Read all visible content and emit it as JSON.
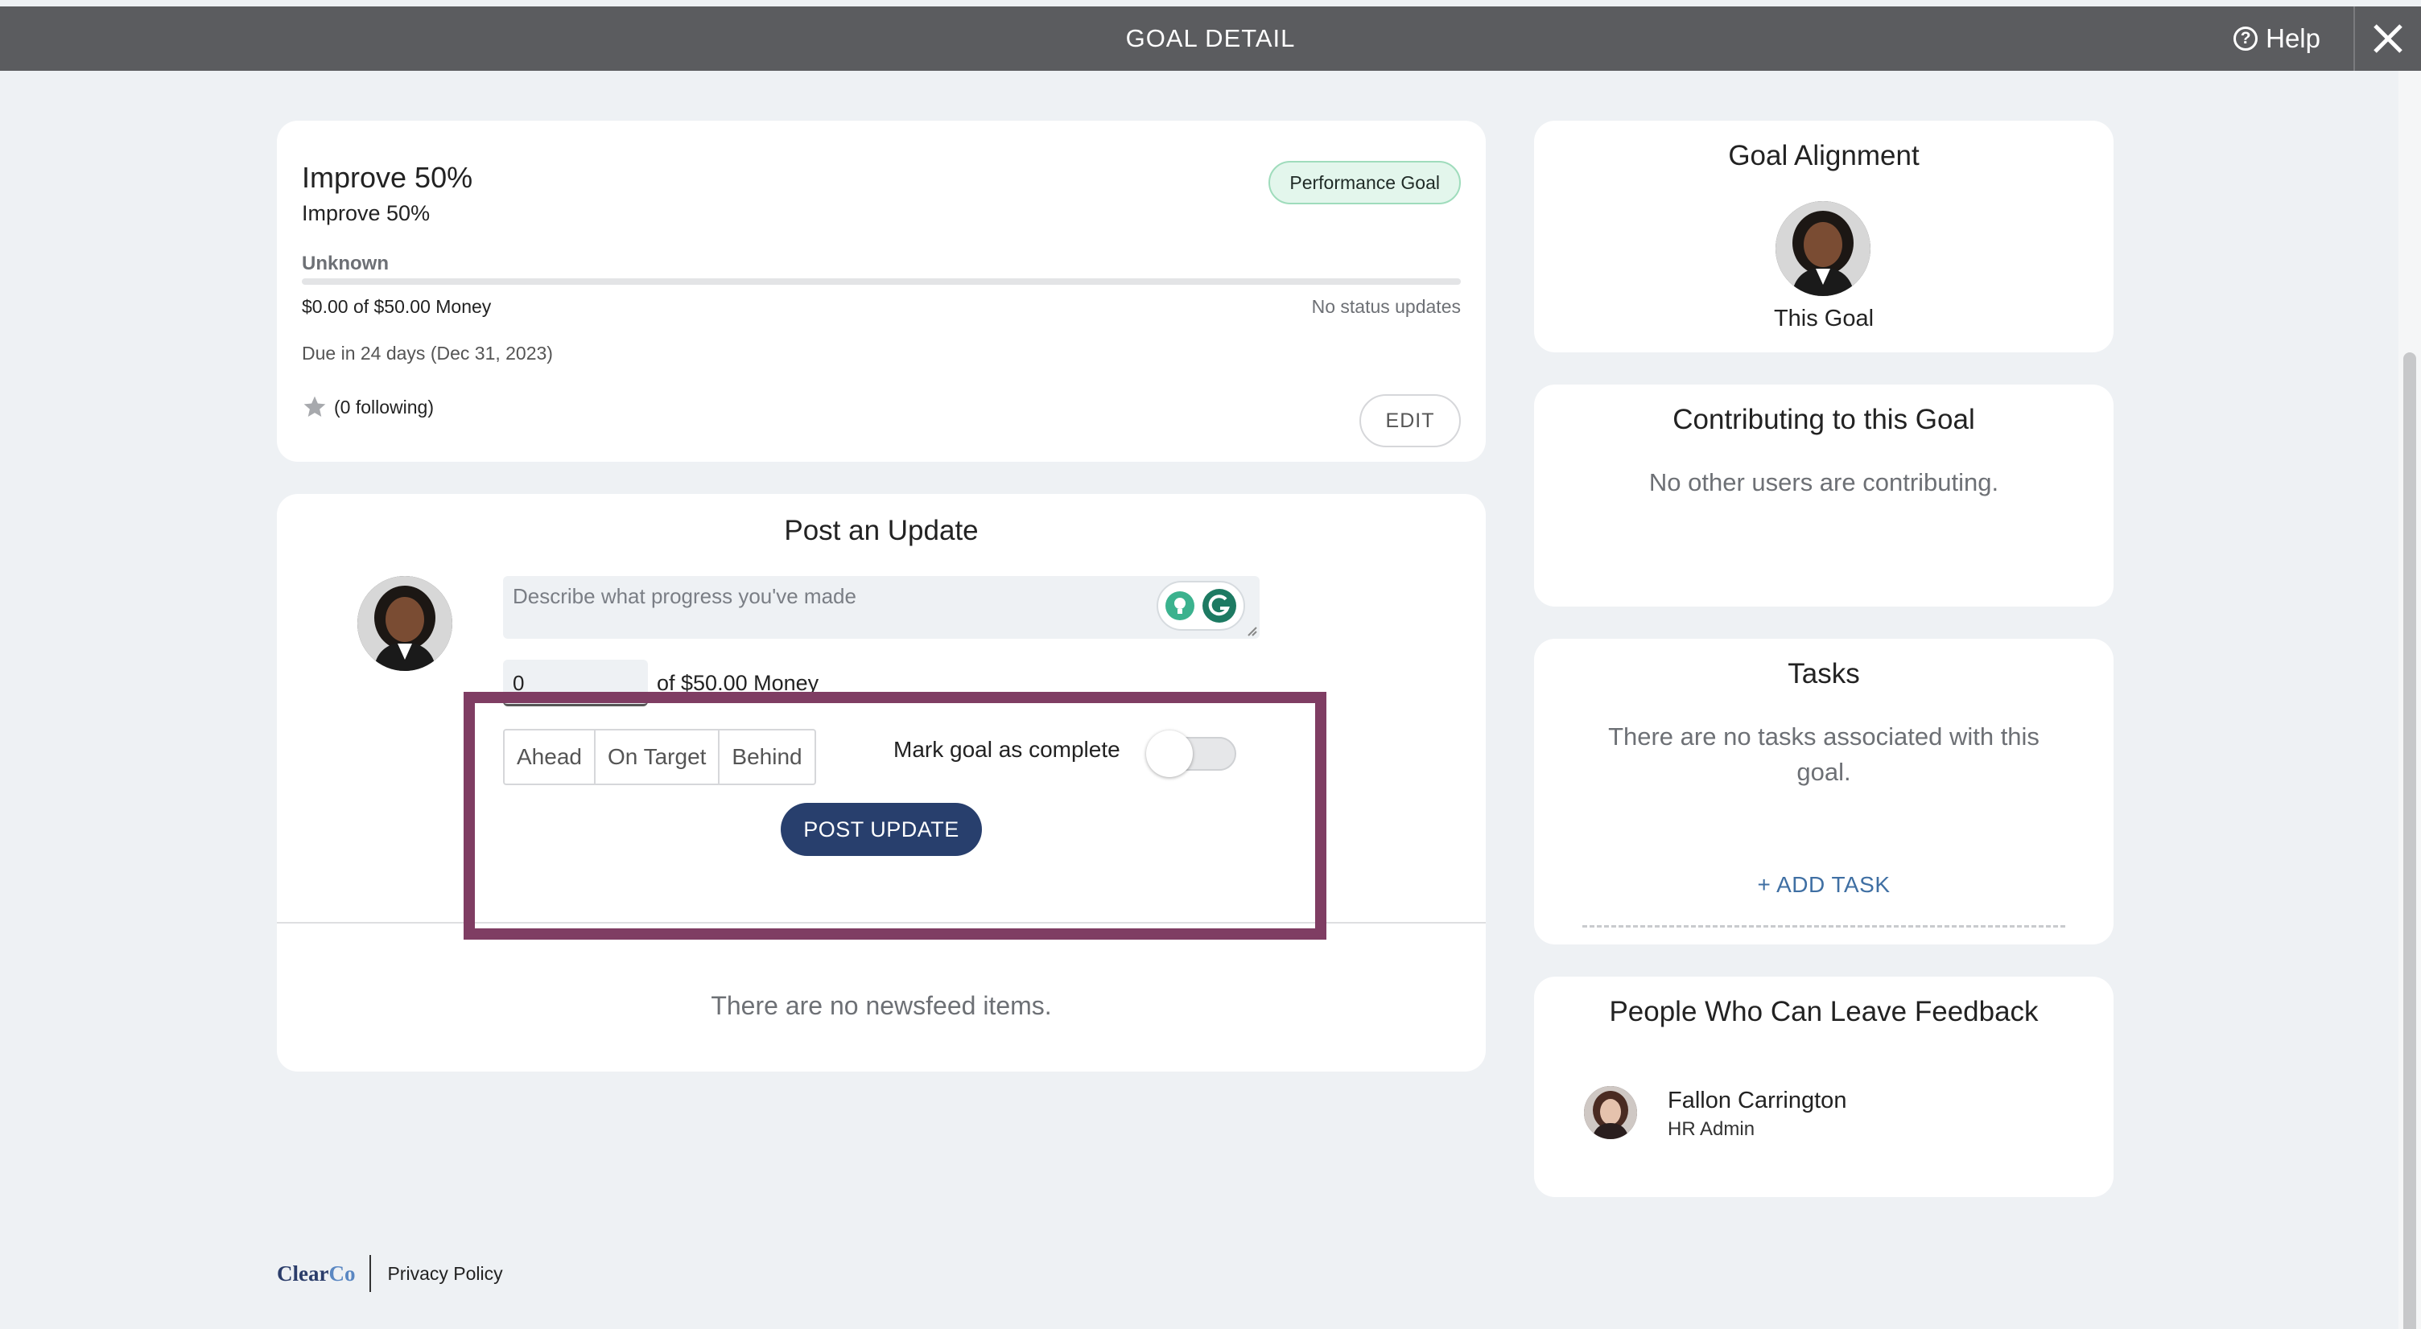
{
  "header": {
    "title": "GOAL DETAIL",
    "help_label": "Help",
    "help_icon": "question-circle-icon",
    "close_icon": "close-icon"
  },
  "goal": {
    "title": "Improve 50%",
    "subtitle": "Improve 50%",
    "badge": "Performance Goal",
    "status": "Unknown",
    "progress_fraction": 0,
    "amount": "$0.00 of $50.00 Money",
    "status_updates": "No status updates",
    "due": "Due in 24 days (Dec 31, 2023)",
    "following": "(0 following)",
    "edit_label": "EDIT",
    "colors": {
      "badge_bg": "#e3f6ec",
      "progress": "#2a7a4f"
    }
  },
  "update": {
    "heading": "Post an Update",
    "placeholder": "Describe what progress you've made",
    "value": "0",
    "of_label": "of $50.00 Money",
    "segments": [
      "Ahead",
      "On Target",
      "Behind"
    ],
    "complete_label": "Mark goal as complete",
    "complete_on": false,
    "post_label": "POST UPDATE",
    "newsfeed_empty": "There are no newsfeed items.",
    "colors": {
      "post_button": "#283f6d",
      "highlight": "#7f3d63"
    }
  },
  "alignment": {
    "heading": "Goal Alignment",
    "caption": "This Goal"
  },
  "contributing": {
    "heading": "Contributing to this Goal",
    "empty": "No other users are contributing."
  },
  "tasks": {
    "heading": "Tasks",
    "empty": "There are no tasks associated with this goal.",
    "add_label": "+ ADD TASK"
  },
  "feedback": {
    "heading": "People Who Can Leave Feedback",
    "people": [
      {
        "name": "Fallon Carrington",
        "role": "HR Admin"
      }
    ]
  },
  "footer": {
    "logo_main": "Clear",
    "logo_accent": "Co",
    "privacy": "Privacy Policy"
  }
}
